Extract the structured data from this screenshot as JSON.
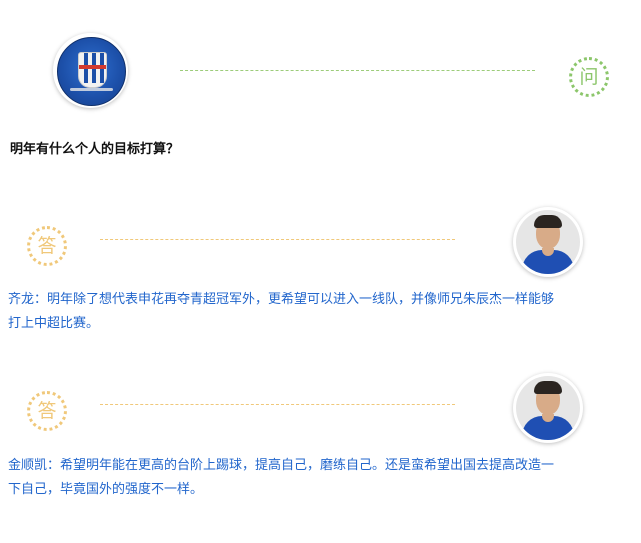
{
  "question": {
    "badge": "问",
    "text": "明年有什么个人的目标打算？"
  },
  "answers": [
    {
      "badge": "答",
      "speaker": "齐龙",
      "line1": "齐龙：明年除了想代表申花再夺青超冠军外，更希望可以进入一线队，并像师兄朱辰杰一样能够",
      "line2": "打上中超比赛。"
    },
    {
      "badge": "答",
      "speaker": "金顺凯",
      "line1": "金顺凯：希望明年能在更高的台阶上踢球，提高自己，磨练自己。还是蛮希望出国去提高改造一",
      "line2": "下自己，毕竟国外的强度不一样。"
    }
  ],
  "colors": {
    "question_accent": "#8cc66b",
    "answer_accent": "#f0c87a",
    "answer_text": "#2266cc",
    "club_blue": "#1c4fa8"
  },
  "icons": [
    "club-logo",
    "question-badge",
    "answer-badge",
    "player-avatar"
  ]
}
